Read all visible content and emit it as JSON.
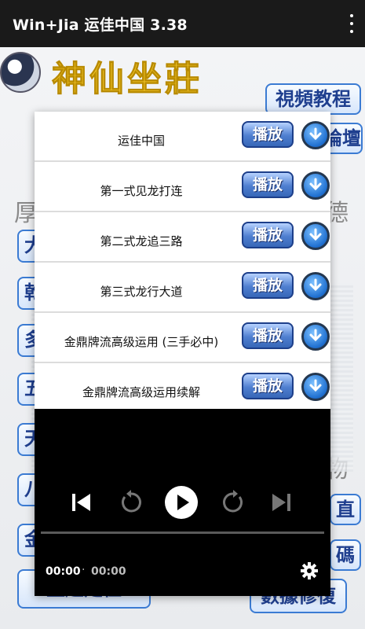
{
  "appbar": {
    "title": "Win+Jia 运佳中国 3.38",
    "menu_icon": "more-vert-icon"
  },
  "background": {
    "brand": "神仙坐莊",
    "buttons": [
      "視頻教程",
      "論壇",
      "數據修復"
    ],
    "side_chars_left": [
      "大",
      "乾",
      "多",
      "五",
      "天",
      "八",
      "金"
    ],
    "side_chars_right": [
      "德",
      "物"
    ],
    "right_buttons": [
      "直",
      "碼"
    ],
    "bottom_left": "主題定位",
    "left_top_char": "厚"
  },
  "list": {
    "items": [
      {
        "label": "运佳中国",
        "play": "播放"
      },
      {
        "label": "第一式见龙打连",
        "play": "播放"
      },
      {
        "label": "第二式龙追三路",
        "play": "播放"
      },
      {
        "label": "第三式龙行大道",
        "play": "播放"
      },
      {
        "label": "金鼎牌流高级运用 (三手必中)",
        "play": "播放"
      },
      {
        "label": "金鼎牌流高级运用续解",
        "play": "播放"
      }
    ]
  },
  "player": {
    "current_time": "00:00",
    "separator": "·",
    "duration": "00:00",
    "progress": 0
  }
}
